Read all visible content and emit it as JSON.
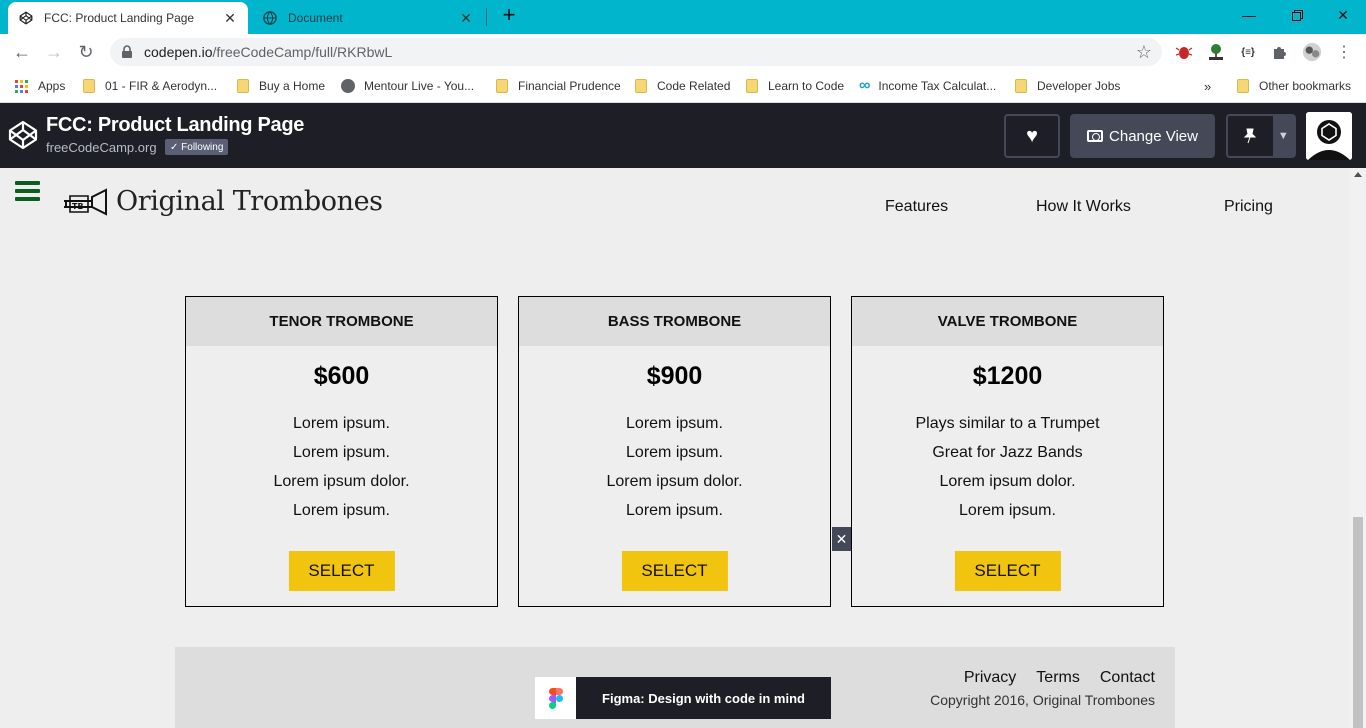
{
  "browser": {
    "tabs": [
      {
        "title": "FCC: Product Landing Page",
        "active": true,
        "icon": "codepen-icon"
      },
      {
        "title": "Document",
        "active": false,
        "icon": "globe-icon"
      }
    ],
    "url_host": "codepen.io",
    "url_path": "/freeCodeCamp/full/RKRbwL",
    "bookmarks": [
      {
        "label": "Apps",
        "icon": "apps-grid-icon"
      },
      {
        "label": "01 - FIR & Aerodyn...",
        "icon": "folder-icon"
      },
      {
        "label": "Buy a Home",
        "icon": "folder-icon"
      },
      {
        "label": "Mentour Live - You...",
        "icon": "globe-icon"
      },
      {
        "label": "Financial Prudence",
        "icon": "folder-icon"
      },
      {
        "label": "Code Related",
        "icon": "folder-icon"
      },
      {
        "label": "Learn to Code",
        "icon": "folder-icon"
      },
      {
        "label": "Income Tax Calculat...",
        "icon": "infinity-icon"
      },
      {
        "label": "Developer Jobs",
        "icon": "folder-icon"
      },
      {
        "label": "Other bookmarks",
        "icon": "folder-icon"
      }
    ],
    "more_chevron": "»"
  },
  "codepen": {
    "title": "FCC: Product Landing Page",
    "owner": "freeCodeCamp.org",
    "follow_label": "✓ Following",
    "change_view_label": "Change View"
  },
  "site": {
    "brand": "Original Trombones",
    "nav": [
      "Features",
      "How It Works",
      "Pricing"
    ],
    "plans": [
      {
        "name": "TENOR TROMBONE",
        "price": "$600",
        "features": [
          "Lorem ipsum.",
          "Lorem ipsum.",
          "Lorem ipsum dolor.",
          "Lorem ipsum."
        ],
        "button": "SELECT"
      },
      {
        "name": "BASS TROMBONE",
        "price": "$900",
        "features": [
          "Lorem ipsum.",
          "Lorem ipsum.",
          "Lorem ipsum dolor.",
          "Lorem ipsum."
        ],
        "button": "SELECT"
      },
      {
        "name": "VALVE TROMBONE",
        "price": "$1200",
        "features": [
          "Plays similar to a Trumpet",
          "Great for Jazz Bands",
          "Lorem ipsum dolor.",
          "Lorem ipsum."
        ],
        "button": "SELECT"
      }
    ],
    "footer": {
      "links": [
        "Privacy",
        "Terms",
        "Contact"
      ],
      "copyright": "Copyright 2016, Original Trombones"
    }
  },
  "ad": {
    "text": "Figma: Design with code in mind",
    "close": "✕"
  },
  "colors": {
    "tabstrip": "#00b5cc",
    "codepen_header": "#1e1f26",
    "select_button": "#f1c40f",
    "hamburger": "#0b5d1e",
    "page_bg": "#eeeeee"
  }
}
